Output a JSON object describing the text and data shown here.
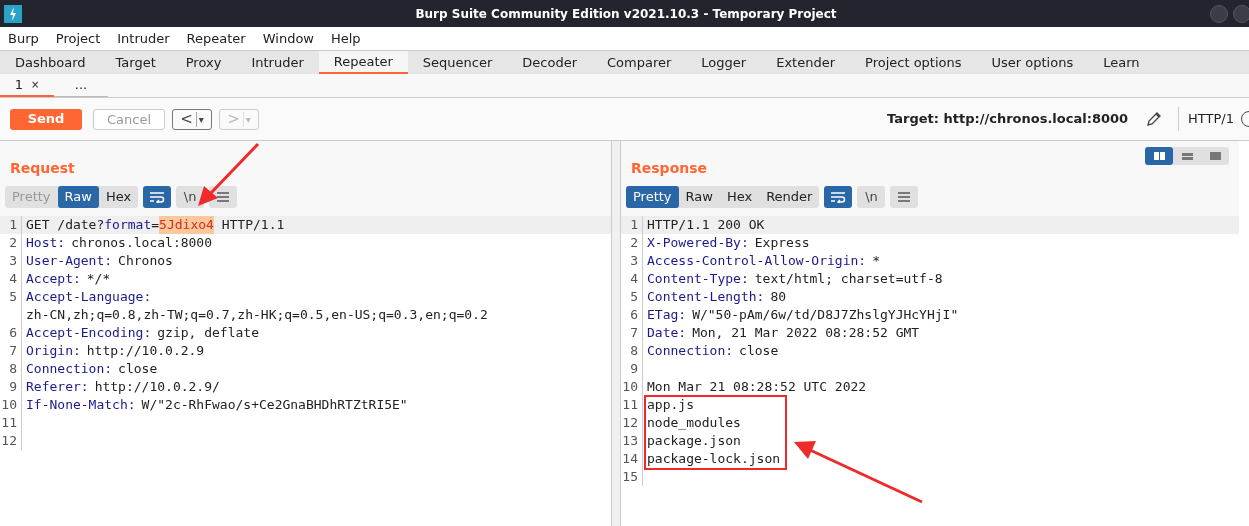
{
  "window": {
    "title": "Burp Suite Community Edition v2021.10.3 - Temporary Project"
  },
  "menu": [
    "Burp",
    "Project",
    "Intruder",
    "Repeater",
    "Window",
    "Help"
  ],
  "tabs": [
    {
      "label": "Dashboard",
      "selected": false
    },
    {
      "label": "Target",
      "selected": false
    },
    {
      "label": "Proxy",
      "selected": false
    },
    {
      "label": "Intruder",
      "selected": false
    },
    {
      "label": "Repeater",
      "selected": true
    },
    {
      "label": "Sequencer",
      "selected": false
    },
    {
      "label": "Decoder",
      "selected": false
    },
    {
      "label": "Comparer",
      "selected": false
    },
    {
      "label": "Logger",
      "selected": false
    },
    {
      "label": "Extender",
      "selected": false
    },
    {
      "label": "Project options",
      "selected": false
    },
    {
      "label": "User options",
      "selected": false
    },
    {
      "label": "Learn",
      "selected": false
    }
  ],
  "repeater_tabs": [
    {
      "label": "1",
      "close": "×",
      "selected": true
    },
    {
      "label": "...",
      "selected": false
    }
  ],
  "toolbar": {
    "send": "Send",
    "cancel": "Cancel",
    "prev": "<",
    "next": ">",
    "dropdown": "▾",
    "target": "Target: http://chronos.local:8000",
    "protocol": "HTTP/1"
  },
  "request": {
    "title": "Request",
    "views": [
      {
        "label": "Pretty",
        "selected": false,
        "disabled": true
      },
      {
        "label": "Raw",
        "selected": true,
        "disabled": false
      },
      {
        "label": "Hex",
        "selected": false,
        "disabled": false
      }
    ],
    "newline": "\\n",
    "lines": [
      {
        "number": "1",
        "segments": [
          {
            "kind": "text",
            "text": "GET /date?"
          },
          {
            "kind": "param",
            "text": "format"
          },
          {
            "kind": "text",
            "text": "="
          },
          {
            "kind": "highlight",
            "text": "5Jdixo4"
          },
          {
            "kind": "text",
            "text": " HTTP/1.1"
          }
        ]
      },
      {
        "number": "2",
        "segments": [
          {
            "kind": "key",
            "text": "Host:"
          },
          {
            "kind": "text",
            "text": "chronos.local:8000"
          }
        ]
      },
      {
        "number": "3",
        "segments": [
          {
            "kind": "key",
            "text": "User-Agent:"
          },
          {
            "kind": "text",
            "text": "Chronos"
          }
        ]
      },
      {
        "number": "4",
        "segments": [
          {
            "kind": "key",
            "text": "Accept:"
          },
          {
            "kind": "text",
            "text": "*/*"
          }
        ]
      },
      {
        "number": "5",
        "segments": [
          {
            "kind": "key",
            "text": "Accept-Language:"
          }
        ],
        "continuation": "zh-CN,zh;q=0.8,zh-TW;q=0.7,zh-HK;q=0.5,en-US;q=0.3,en;q=0.2"
      },
      {
        "number": "6",
        "segments": [
          {
            "kind": "key",
            "text": "Accept-Encoding:"
          },
          {
            "kind": "text",
            "text": "gzip, deflate"
          }
        ]
      },
      {
        "number": "7",
        "segments": [
          {
            "kind": "key",
            "text": "Origin:"
          },
          {
            "kind": "text",
            "text": "http://10.0.2.9"
          }
        ]
      },
      {
        "number": "8",
        "segments": [
          {
            "kind": "key",
            "text": "Connection:"
          },
          {
            "kind": "text",
            "text": "close"
          }
        ]
      },
      {
        "number": "9",
        "segments": [
          {
            "kind": "key",
            "text": "Referer:"
          },
          {
            "kind": "text",
            "text": "http://10.0.2.9/"
          }
        ]
      },
      {
        "number": "10",
        "segments": [
          {
            "kind": "key",
            "text": "If-None-Match:"
          },
          {
            "kind": "text",
            "text": "W/\"2c-RhFwao/s+Ce2GnaBHDhRTZtRI5E\""
          }
        ]
      },
      {
        "number": "11"
      },
      {
        "number": "12"
      }
    ]
  },
  "response": {
    "title": "Response",
    "views": [
      {
        "label": "Pretty",
        "selected": true,
        "disabled": false
      },
      {
        "label": "Raw",
        "selected": false,
        "disabled": false
      },
      {
        "label": "Hex",
        "selected": false,
        "disabled": false
      },
      {
        "label": "Render",
        "selected": false,
        "disabled": false
      }
    ],
    "newline": "\\n",
    "lines": [
      {
        "number": "1",
        "segments": [
          {
            "kind": "text",
            "text": "HTTP/1.1 200 OK"
          }
        ]
      },
      {
        "number": "2",
        "segments": [
          {
            "kind": "key",
            "text": "X-Powered-By:"
          },
          {
            "kind": "text",
            "text": "Express"
          }
        ]
      },
      {
        "number": "3",
        "segments": [
          {
            "kind": "key",
            "text": "Access-Control-Allow-Origin:"
          },
          {
            "kind": "text",
            "text": "*"
          }
        ]
      },
      {
        "number": "4",
        "segments": [
          {
            "kind": "key",
            "text": "Content-Type:"
          },
          {
            "kind": "text",
            "text": "text/html; charset=utf-8"
          }
        ]
      },
      {
        "number": "5",
        "segments": [
          {
            "kind": "key",
            "text": "Content-Length:"
          },
          {
            "kind": "text",
            "text": "80"
          }
        ]
      },
      {
        "number": "6",
        "segments": [
          {
            "kind": "key",
            "text": "ETag:"
          },
          {
            "kind": "text",
            "text": "W/\"50-pAm/6w/td/D8J7ZhslgYJHcYHjI\""
          }
        ]
      },
      {
        "number": "7",
        "segments": [
          {
            "kind": "key",
            "text": "Date:"
          },
          {
            "kind": "text",
            "text": "Mon, 21 Mar 2022 08:28:52 GMT"
          }
        ]
      },
      {
        "number": "8",
        "segments": [
          {
            "kind": "key",
            "text": "Connection:"
          },
          {
            "kind": "text",
            "text": "close"
          }
        ]
      },
      {
        "number": "9"
      },
      {
        "number": "10",
        "segments": [
          {
            "kind": "text",
            "text": "Mon Mar 21 08:28:52 UTC 2022"
          }
        ]
      },
      {
        "number": "11",
        "segments": [
          {
            "kind": "text",
            "text": "app.js"
          }
        ],
        "boxed": true
      },
      {
        "number": "12",
        "segments": [
          {
            "kind": "text",
            "text": "node_modules"
          }
        ],
        "boxed": true
      },
      {
        "number": "13",
        "segments": [
          {
            "kind": "text",
            "text": "package.json"
          }
        ],
        "boxed": true
      },
      {
        "number": "14",
        "segments": [
          {
            "kind": "text",
            "text": "package-lock.json"
          }
        ],
        "boxed": true
      },
      {
        "number": "15"
      }
    ]
  }
}
